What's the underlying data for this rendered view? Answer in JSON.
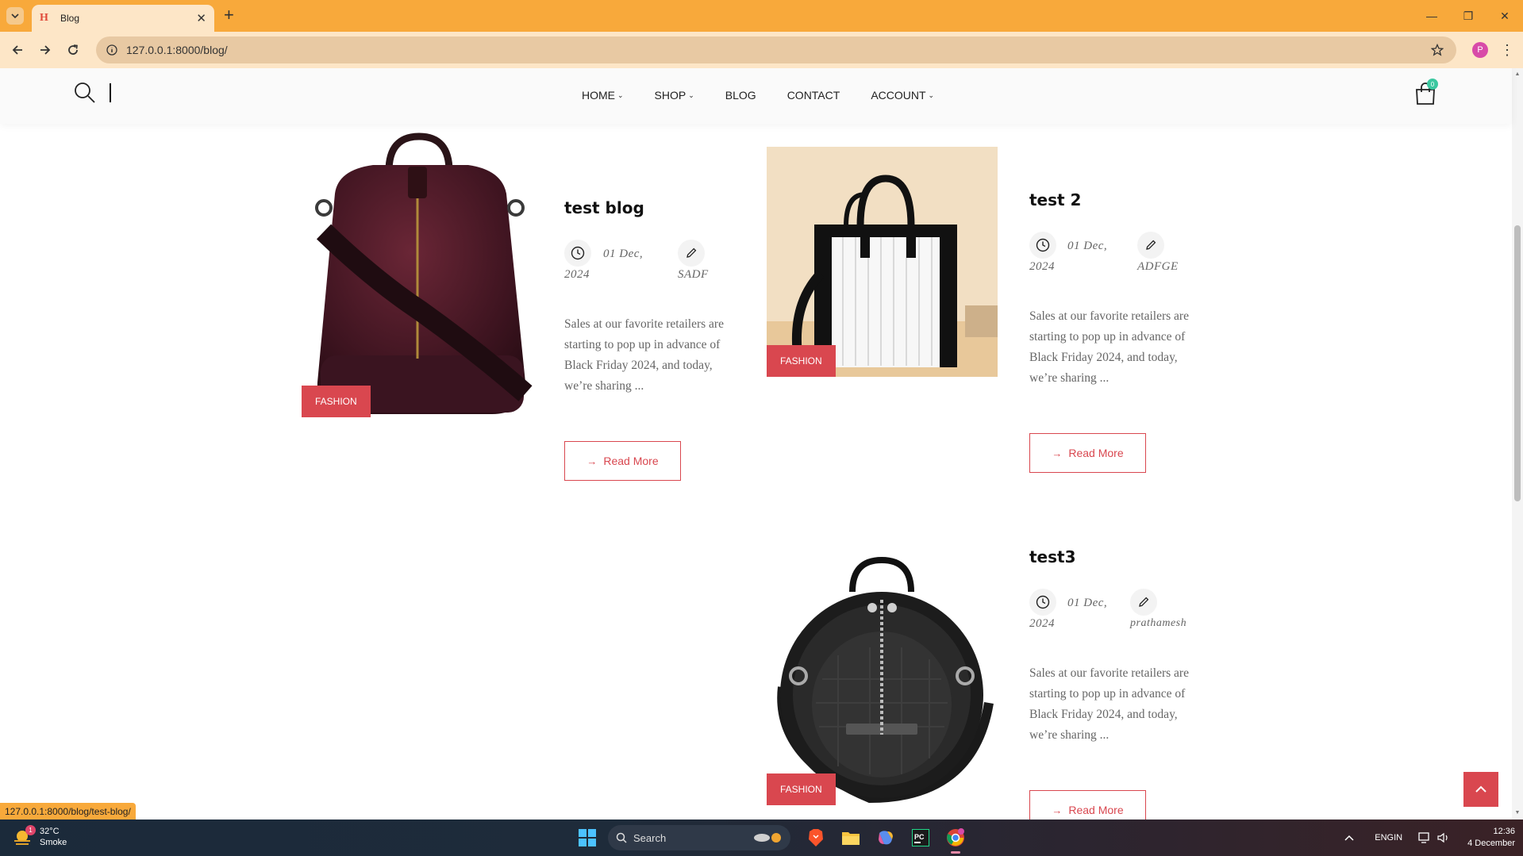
{
  "browser": {
    "tab_title": "Blog",
    "url": "127.0.0.1:8000/blog/",
    "profile_initial": "P",
    "status_url": "127.0.0.1:8000/blog/test-blog/"
  },
  "header": {
    "nav": [
      {
        "label": "HOME",
        "has_dropdown": true
      },
      {
        "label": "SHOP",
        "has_dropdown": true
      },
      {
        "label": "BLOG",
        "has_dropdown": false
      },
      {
        "label": "CONTACT",
        "has_dropdown": false
      },
      {
        "label": "ACCOUNT",
        "has_dropdown": true
      }
    ],
    "cart_count": "0"
  },
  "posts": [
    {
      "title": "test blog",
      "category": "FASHION",
      "date_line1": "01 Dec,",
      "date_line2": "2024",
      "author": "SADF",
      "excerpt": "Sales at our favorite retailers are starting to pop up in advance of Black Friday 2024, and today, we’re sharing ...",
      "read_more": "Read More",
      "image": "maroon-backpack"
    },
    {
      "title": "test 2",
      "category": "FASHION",
      "date_line1": "01 Dec,",
      "date_line2": "2024",
      "author": "ADFGE",
      "excerpt": "Sales at our favorite retailers are starting to pop up in advance of Black Friday 2024, and today, we’re sharing ...",
      "read_more": "Read More",
      "image": "black-white-tote"
    },
    {
      "title": "test3",
      "category": "FASHION",
      "date_line1": "01 Dec,",
      "date_line2": "2024",
      "author": "prathamesh",
      "excerpt": "Sales at our favorite retailers are starting to pop up in advance of Black Friday 2024, and today, we’re sharing ...",
      "read_more": "Read More",
      "image": "round-black-bag"
    }
  ],
  "taskbar": {
    "weather_temp": "32°C",
    "weather_desc": "Smoke",
    "weather_badge": "1",
    "search_placeholder": "Search",
    "lang_line1": "ENG",
    "lang_line2": "IN",
    "time": "12:36",
    "date": "4 December"
  },
  "colors": {
    "accent": "#d9474f",
    "tabbar": "#f8a93b",
    "toolbar": "#fde6c7"
  }
}
